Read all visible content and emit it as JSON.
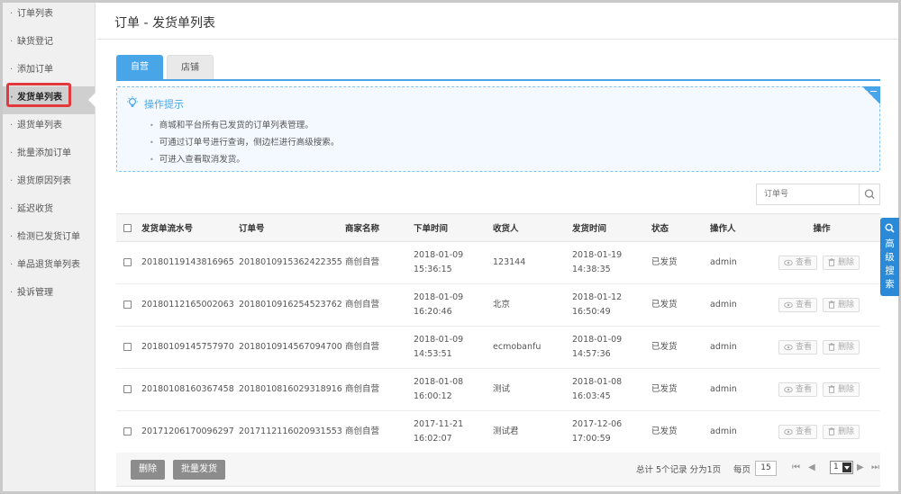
{
  "sidebar": {
    "items": [
      {
        "label": "订单列表"
      },
      {
        "label": "缺货登记"
      },
      {
        "label": "添加订单"
      },
      {
        "label": "发货单列表"
      },
      {
        "label": "退货单列表"
      },
      {
        "label": "批量添加订单"
      },
      {
        "label": "退货原因列表"
      },
      {
        "label": "延迟收货"
      },
      {
        "label": "检测已发货订单"
      },
      {
        "label": "单品退货单列表"
      },
      {
        "label": "投诉管理"
      }
    ],
    "active_index": 3
  },
  "header": {
    "title": "订单 - 发货单列表"
  },
  "tabs": [
    {
      "label": "自营"
    },
    {
      "label": "店铺"
    }
  ],
  "tips": {
    "title": "操作提示",
    "items": [
      "商城和平台所有已发货的订单列表管理。",
      "可通过订单号进行查询，侧边栏进行高级搜索。",
      "可进入查看取消发货。"
    ]
  },
  "search": {
    "placeholder": "订单号",
    "icon": "search-icon"
  },
  "table": {
    "headers": [
      "发货单流水号",
      "订单号",
      "商家名称",
      "下单时间",
      "收货人",
      "发货时间",
      "状态",
      "操作人",
      "操作"
    ],
    "rows": [
      {
        "sn": "20180119143816965",
        "order": "2018010915362422355",
        "shop": "商创自营",
        "order_date": "2018-01-09",
        "order_time": "15:36:15",
        "consignee": "123144",
        "ship_date": "2018-01-19",
        "ship_time": "14:38:35",
        "status": "已发货",
        "operator": "admin"
      },
      {
        "sn": "20180112165002063",
        "order": "2018010916254523762",
        "shop": "商创自营",
        "order_date": "2018-01-09",
        "order_time": "16:20:46",
        "consignee": "北京",
        "ship_date": "2018-01-12",
        "ship_time": "16:50:49",
        "status": "已发货",
        "operator": "admin"
      },
      {
        "sn": "20180109145757970",
        "order": "2018010914567094700",
        "shop": "商创自营",
        "order_date": "2018-01-09",
        "order_time": "14:53:51",
        "consignee": "ecmobanfu",
        "ship_date": "2018-01-09",
        "ship_time": "14:57:36",
        "status": "已发货",
        "operator": "admin"
      },
      {
        "sn": "20180108160367458",
        "order": "2018010816029318916",
        "shop": "商创自营",
        "order_date": "2018-01-08",
        "order_time": "16:00:12",
        "consignee": "测试",
        "ship_date": "2018-01-08",
        "ship_time": "16:03:45",
        "status": "已发货",
        "operator": "admin"
      },
      {
        "sn": "20171206170096297",
        "order": "2017112116020931553",
        "shop": "商创自营",
        "order_date": "2017-11-21",
        "order_time": "16:02:07",
        "consignee": "测试君",
        "ship_date": "2017-12-06",
        "ship_time": "17:00:59",
        "status": "已发货",
        "operator": "admin"
      }
    ],
    "view_label": "查看",
    "delete_label": "删除"
  },
  "footer": {
    "delete_btn": "删除",
    "batch_btn": "批量发货",
    "summary": "总计 5个记录 分为1页",
    "per_page_label": "每页",
    "per_page": "15",
    "current_page": "1"
  },
  "adv_search": {
    "chars": [
      "高",
      "级",
      "搜",
      "索"
    ]
  },
  "colors": {
    "accent": "#48a6e8",
    "shop_red": "#e4393c",
    "link_blue": "#2aa0d8",
    "highlight": "#e4393c"
  }
}
